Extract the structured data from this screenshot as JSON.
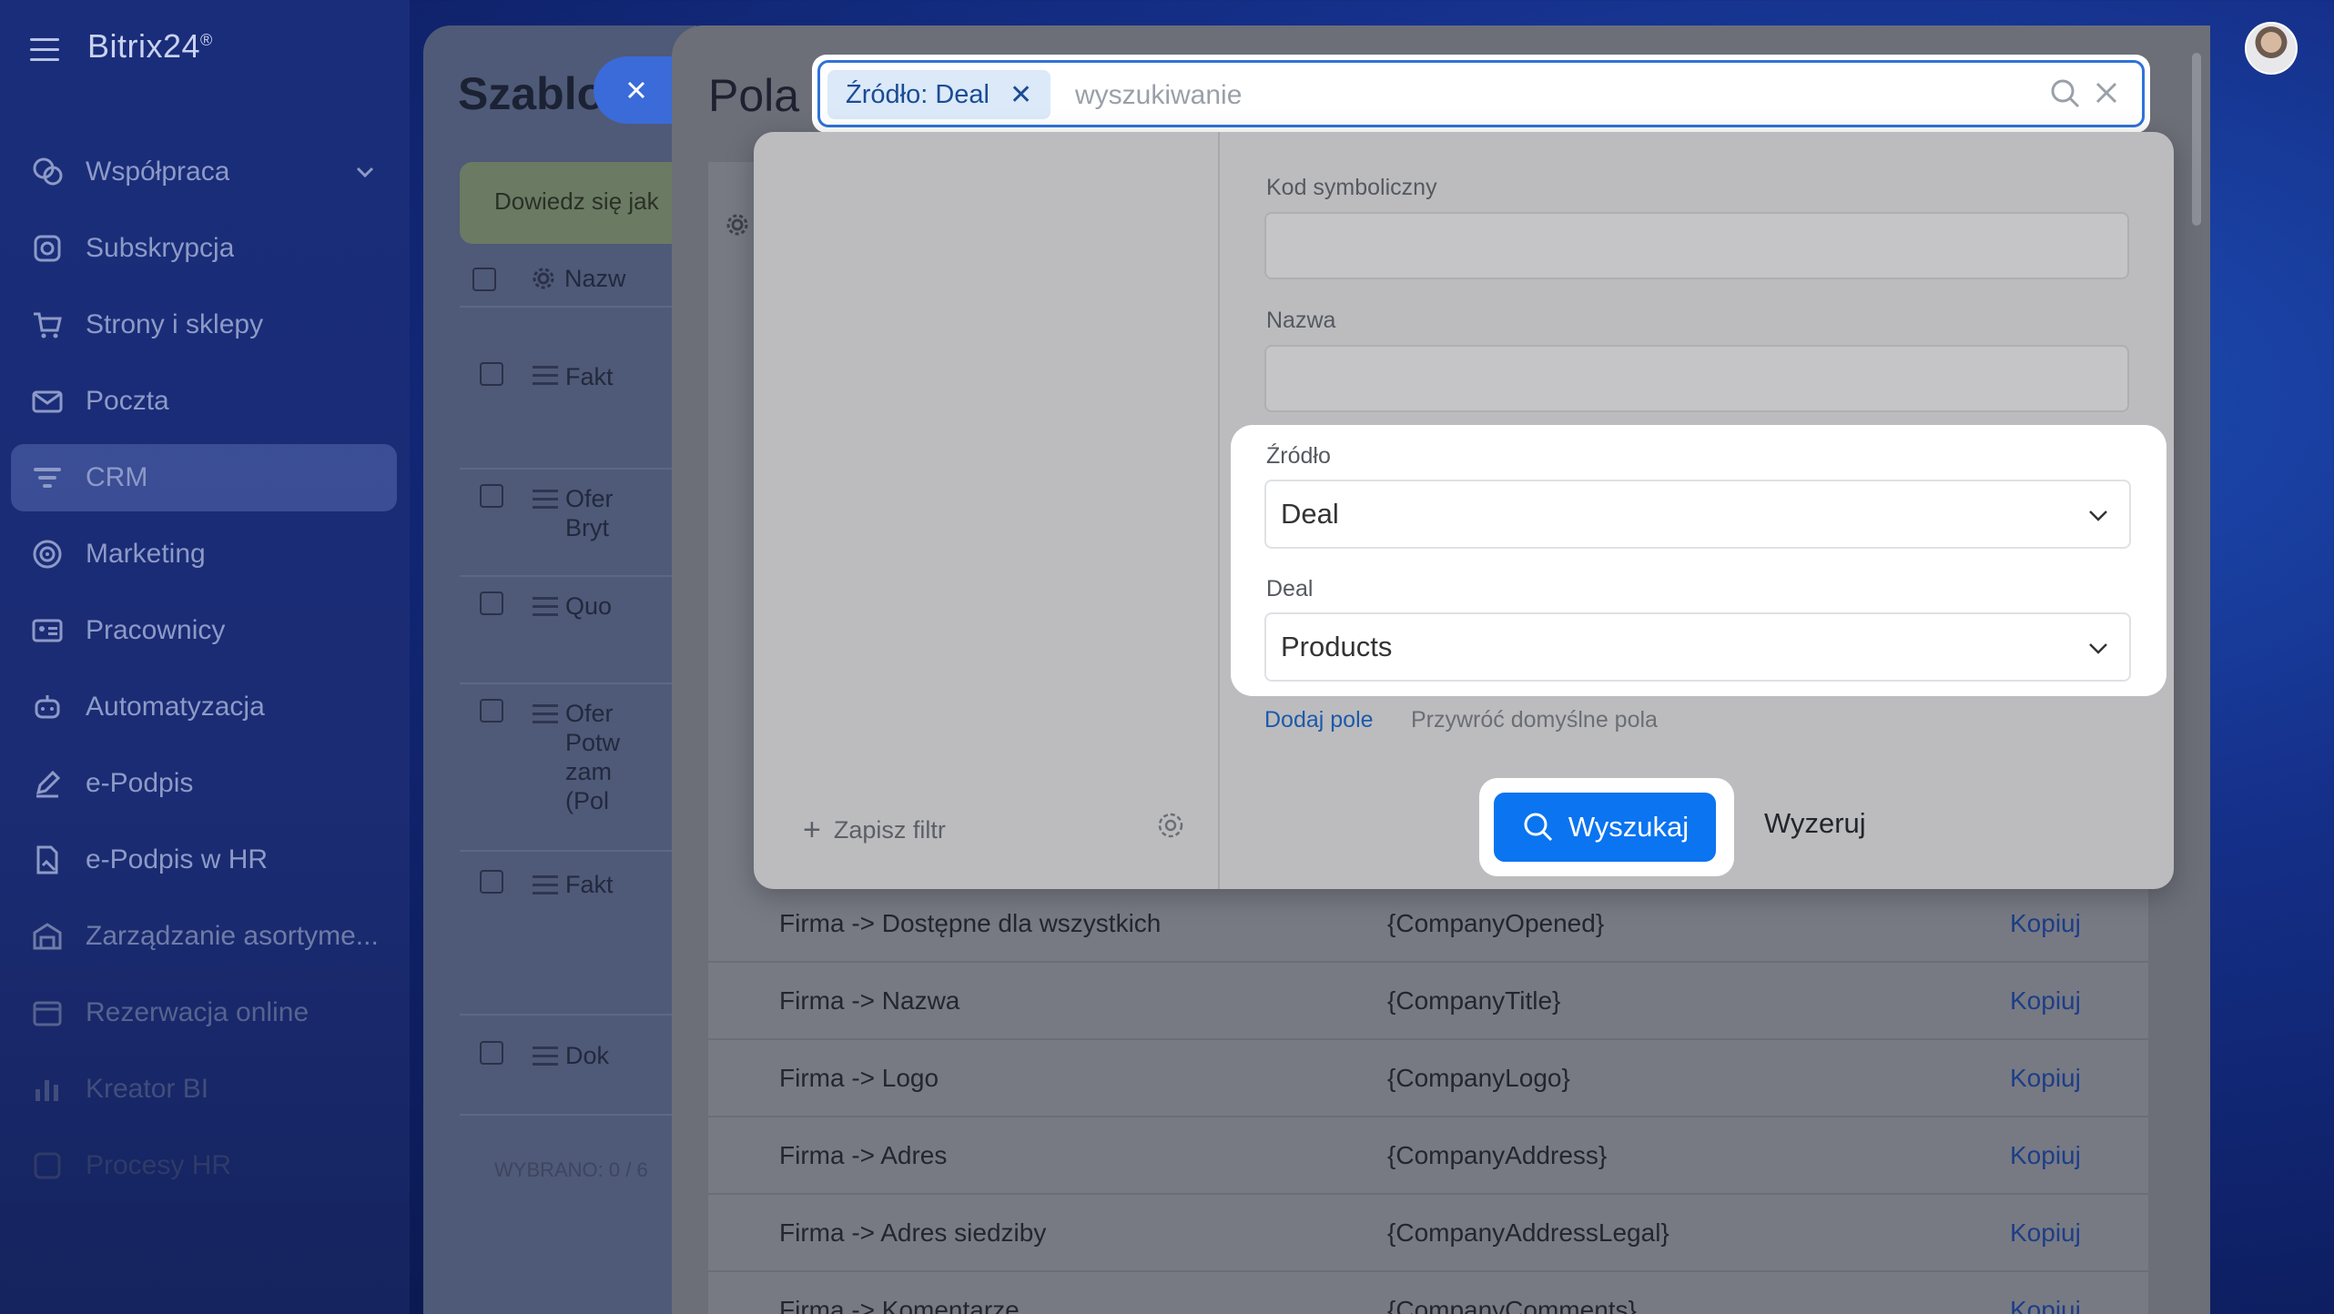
{
  "app": {
    "brand": "Bitrix24",
    "brand_mark": "®"
  },
  "sidebar": {
    "items": [
      {
        "label": "Współpraca",
        "icon": "chat-bubbles-icon",
        "has_chevron": true
      },
      {
        "label": "Subskrypcja",
        "icon": "subscription-icon"
      },
      {
        "label": "Strony i sklepy",
        "icon": "cart-icon"
      },
      {
        "label": "Poczta",
        "icon": "mail-icon"
      },
      {
        "label": "CRM",
        "icon": "funnel-icon",
        "active": true
      },
      {
        "label": "Marketing",
        "icon": "target-icon"
      },
      {
        "label": "Pracownicy",
        "icon": "id-card-icon"
      },
      {
        "label": "Automatyzacja",
        "icon": "robot-icon"
      },
      {
        "label": "e-Podpis",
        "icon": "pen-icon"
      },
      {
        "label": "e-Podpis w HR",
        "icon": "signed-doc-icon"
      },
      {
        "label": "Zarządzanie asortyme...",
        "icon": "warehouse-icon"
      },
      {
        "label": "Rezerwacja online",
        "icon": "calendar-icon"
      },
      {
        "label": "Kreator BI",
        "icon": "bar-chart-icon"
      },
      {
        "label": "Procesy HR",
        "icon": "process-icon"
      }
    ]
  },
  "background_page": {
    "title": "Szablo",
    "banner": "Dowiedz się jak",
    "header_col": "Nazw",
    "rows": [
      {
        "text": "Fakt"
      },
      {
        "text": "Ofer\nBryt"
      },
      {
        "text": "Quo"
      },
      {
        "text": "Ofer\nPotw\nzam\n(Pol"
      },
      {
        "text": "Fakt"
      },
      {
        "text": "Dok"
      }
    ],
    "footer": "WYBRANO: 0 / 6"
  },
  "pola": {
    "title": "Pola",
    "rows": [
      {
        "name": "Firma -> Dostępne dla wszystkich",
        "code": "{CompanyOpened}",
        "action": "Kopiuj"
      },
      {
        "name": "Firma -> Nazwa",
        "code": "{CompanyTitle}",
        "action": "Kopiuj"
      },
      {
        "name": "Firma -> Logo",
        "code": "{CompanyLogo}",
        "action": "Kopiuj"
      },
      {
        "name": "Firma -> Adres",
        "code": "{CompanyAddress}",
        "action": "Kopiuj"
      },
      {
        "name": "Firma -> Adres siedziby",
        "code": "{CompanyAddressLegal}",
        "action": "Kopiuj"
      },
      {
        "name": "Firma -> Komentarze",
        "code": "{CompanyComments}",
        "action": "Kopiuj"
      }
    ]
  },
  "search": {
    "chip_label": "Źródło: Deal",
    "placeholder": "wyszukiwanie",
    "value": ""
  },
  "filter": {
    "save_filter": "Zapisz filtr",
    "fields": {
      "code_label": "Kod symboliczny",
      "code_value": "",
      "name_label": "Nazwa",
      "name_value": "",
      "source_label": "Źródło",
      "source_value": "Deal",
      "deal_label": "Deal",
      "deal_value": "Products"
    },
    "add_field": "Dodaj pole",
    "restore_fields": "Przywróć domyślne pola",
    "search_button": "Wyszukaj",
    "reset_button": "Wyzeruj"
  },
  "colors": {
    "primary": "#0b74f0",
    "link": "#1d5aa8",
    "chip_bg": "#dbe9f9",
    "search_border": "#2f73d9"
  }
}
